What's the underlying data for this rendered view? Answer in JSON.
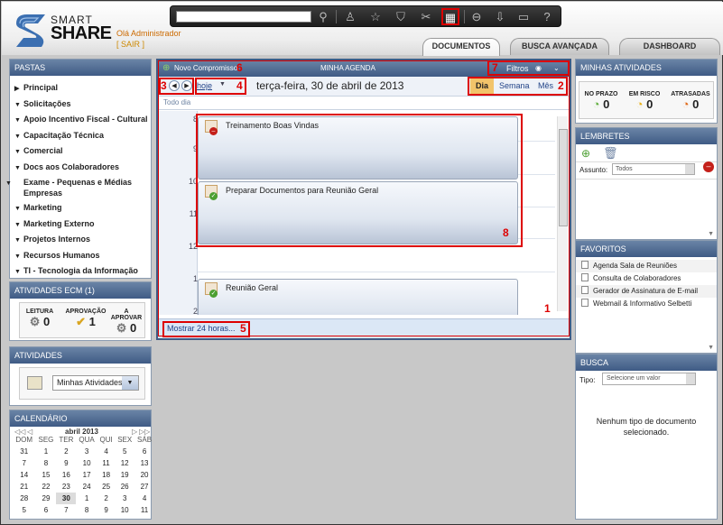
{
  "header": {
    "logo_smart": "SMART",
    "logo_share": "SHARE",
    "greeting": "Olá Administrador",
    "logout": "[ SAIR ]",
    "search_value": "",
    "tabs": [
      {
        "label": "DOCUMENTOS"
      },
      {
        "label": "BUSCA AVANÇADA"
      },
      {
        "label": "DASHBOARD"
      }
    ],
    "toolbar_icons": [
      "search-icon",
      "user-icon",
      "star-icon",
      "tag-icon",
      "tools-icon",
      "calendar-icon",
      "printer-icon",
      "download-icon",
      "window-icon",
      "help-icon"
    ]
  },
  "folders": {
    "title": "PASTAS",
    "items": [
      "Principal",
      "Solicitações",
      "Apoio Incentivo Fiscal - Cultural",
      "Capacitação Técnica",
      "Comercial",
      "Docs aos Colaboradores",
      "Exame - Pequenas e Médias Empresas",
      "Marketing",
      "Marketing Externo",
      "Projetos Internos",
      "Recursos Humanos",
      "TI - Tecnologia da Informação"
    ]
  },
  "ecm": {
    "title": "ATIVIDADES ECM (1)",
    "cols": [
      {
        "label": "LEITURA",
        "value": "0"
      },
      {
        "label": "APROVAÇÃO",
        "value": "1"
      },
      {
        "label": "A APROVAR",
        "value": "0"
      }
    ]
  },
  "activities": {
    "title": "ATIVIDADES",
    "select": "Minhas Atividades"
  },
  "calendar": {
    "title": "CALENDÁRIO",
    "month": "abril 2013",
    "days": [
      "DOM",
      "SEG",
      "TER",
      "QUA",
      "QUI",
      "SEX",
      "SÁB"
    ],
    "weeks": [
      [
        "31",
        "1",
        "2",
        "3",
        "4",
        "5",
        "6"
      ],
      [
        "7",
        "8",
        "9",
        "10",
        "11",
        "12",
        "13"
      ],
      [
        "14",
        "15",
        "16",
        "17",
        "18",
        "19",
        "20"
      ],
      [
        "21",
        "22",
        "23",
        "24",
        "25",
        "26",
        "27"
      ],
      [
        "28",
        "29",
        "30",
        "1",
        "2",
        "3",
        "4"
      ],
      [
        "5",
        "6",
        "7",
        "8",
        "9",
        "10",
        "11"
      ]
    ],
    "today": "30"
  },
  "agenda": {
    "title": "MINHA AGENDA",
    "new_label": "Novo Compromisso",
    "filters": "Filtros",
    "today_link": "hoje",
    "date": "terça-feira, 30 de abril de 2013",
    "views": [
      "Dia",
      "Semana",
      "Mês"
    ],
    "all_day": "Todo dia",
    "hours": [
      "8",
      "9",
      "10",
      "11",
      "12",
      "1",
      "2"
    ],
    "events": [
      {
        "title": "Treinamento Boas Vindas",
        "status": "cancelled"
      },
      {
        "title": "Preparar Documentos para Reunião Geral",
        "status": "done"
      },
      {
        "title": "Reunião Geral",
        "status": "done"
      }
    ],
    "show_24h": "Mostrar 24 horas...",
    "markers": [
      "1",
      "2",
      "3",
      "4",
      "5",
      "6",
      "7",
      "8"
    ]
  },
  "my_activities": {
    "title": "MINHAS ATIVIDADES",
    "cols": [
      {
        "label": "NO PRAZO",
        "value": "0",
        "color": "#5fae3c"
      },
      {
        "label": "EM RISCO",
        "value": "0",
        "color": "#e8b11a"
      },
      {
        "label": "ATRASADAS",
        "value": "0",
        "color": "#e06a1a"
      }
    ]
  },
  "reminders": {
    "title": "LEMBRETES",
    "subject_label": "Assunto:",
    "subject_value": "Todos"
  },
  "favorites": {
    "title": "FAVORITOS",
    "items": [
      "Agenda Sala de Reuniões",
      "Consulta de Colaboradores",
      "Gerador de Assinatura de E-mail",
      "Webmail & Informativo Selbetti"
    ]
  },
  "search": {
    "title": "BUSCA",
    "type_label": "Tipo:",
    "type_placeholder": "Selecione um valor",
    "empty": "Nenhum tipo de documento selecionado."
  }
}
